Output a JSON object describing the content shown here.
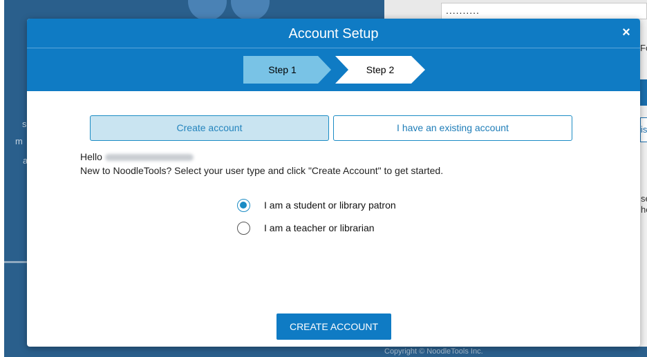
{
  "background": {
    "password_dots": "..........",
    "copyright": "Copyright © NoodleTools Inc.",
    "fragments": [
      "Fo",
      "is",
      "se",
      "he",
      "s",
      "m",
      "a"
    ]
  },
  "modal": {
    "title": "Account Setup",
    "close_icon": "×",
    "steps": [
      {
        "label": "Step 1",
        "state": "active"
      },
      {
        "label": "Step 2",
        "state": "inactive"
      }
    ],
    "tabs": [
      {
        "label": "Create account",
        "selected": true
      },
      {
        "label": "I have an existing account",
        "selected": false
      }
    ],
    "greeting": "Hello",
    "intro_text": "New to NoodleTools? Select your user type and click \"Create Account\" to get started.",
    "user_types": [
      {
        "label": "I am a student or library patron",
        "checked": true
      },
      {
        "label": "I am a teacher or librarian",
        "checked": false
      }
    ],
    "create_button": "CREATE ACCOUNT"
  },
  "colors": {
    "header_blue": "#0f7bc4",
    "step_active": "#79c3e6",
    "tab_selected_bg": "#c9e4f1",
    "accent": "#1a8bc4"
  }
}
